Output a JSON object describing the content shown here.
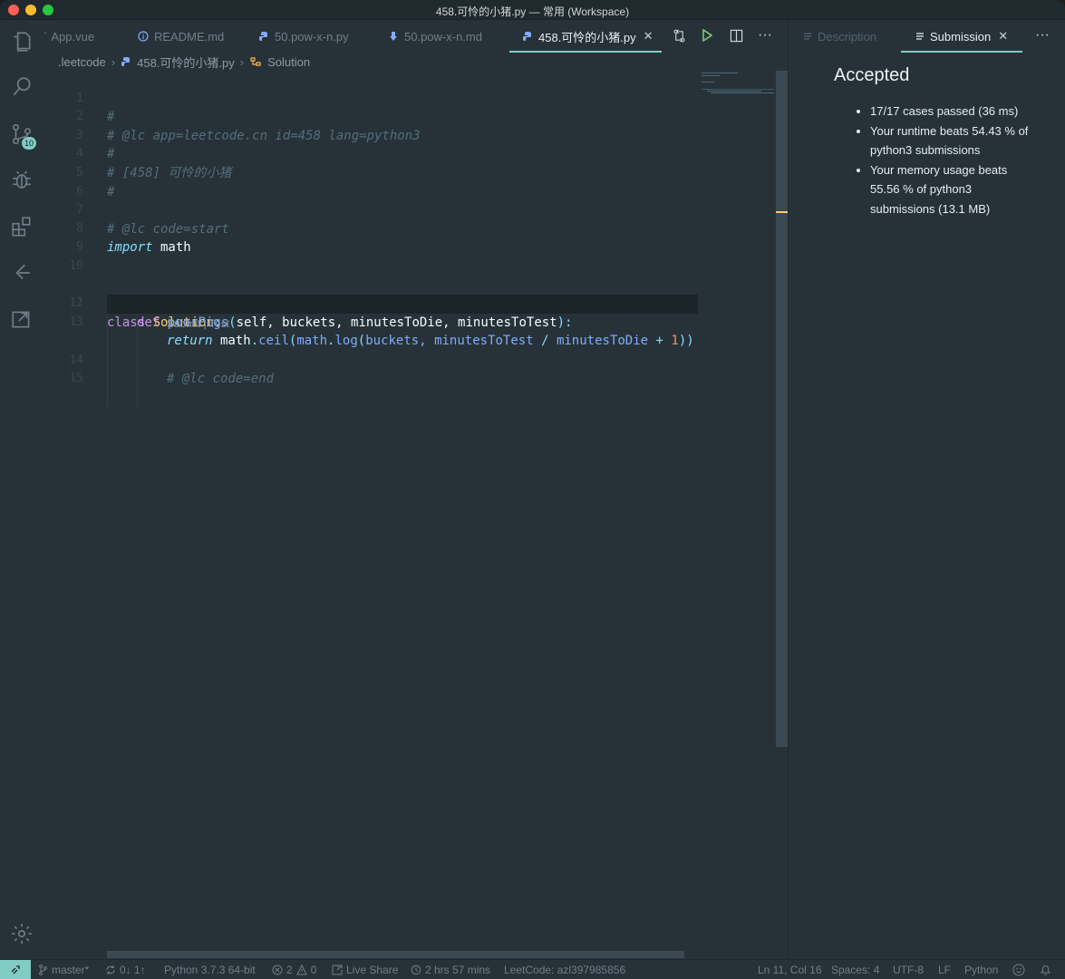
{
  "window": {
    "title": "458.可怜的小猪.py — 常用 (Workspace)"
  },
  "activity_bar": {
    "items": [
      {
        "name": "explorer-icon"
      },
      {
        "name": "search-icon"
      },
      {
        "name": "source-control-icon",
        "badge": "10"
      },
      {
        "name": "debug-icon"
      },
      {
        "name": "extensions-icon"
      },
      {
        "name": "leetcode-icon"
      },
      {
        "name": "remote-explorer-icon"
      }
    ],
    "settings": "gear-icon"
  },
  "tabs": [
    {
      "label": "App.vue",
      "icon": "vue-icon"
    },
    {
      "label": "README.md",
      "icon": "info-icon"
    },
    {
      "label": "50.pow-x-n.py",
      "icon": "python-icon"
    },
    {
      "label": "50.pow-x-n.md",
      "icon": "markdown-icon"
    },
    {
      "label": "458.可怜的小猪.py",
      "icon": "python-icon",
      "active": true
    }
  ],
  "editor_actions": [
    "compare-icon",
    "run-icon",
    "split-editor-icon",
    "more-icon"
  ],
  "breadcrumb": {
    "folder": ".leetcode",
    "file": "458.可怜的小猪.py",
    "symbol": "Solution"
  },
  "code": {
    "lines": [
      "1",
      "2",
      "3",
      "4",
      "5",
      "6",
      "7",
      "8",
      "9",
      "10",
      "11",
      "12",
      "13",
      "14",
      "15"
    ],
    "l1": "#",
    "l2": "# @lc app=leetcode.cn id=458 lang=python3",
    "l3": "#",
    "l4": "# [458] 可怜的小猪",
    "l5": "#",
    "l7": "# @lc code=start",
    "l8_kw": "import",
    "l8_mod": " math",
    "l11_kw": "class",
    "l11_cls": " Solution",
    "l11_colon": ":",
    "l12_kw": "def",
    "l12_fn": " poorPigs",
    "l12_open": "(",
    "l12_params": "self, buckets, minutesToDie, minutesToTest",
    "l12_close": "):",
    "l13_kw": "return",
    "l13_math1": " math",
    "l13_dot1": ".",
    "l13_ceil": "ceil",
    "l13_p1": "(",
    "l13_math2": "math",
    "l13_dot2": ".",
    "l13_log": "log",
    "l13_p2": "(",
    "l13_buckets": "buckets, ",
    "l13_mtt": "minutesToTest",
    "l13_div": " / ",
    "l13_mtd": "minutesToDie",
    "l13_plus": " + ",
    "l13_one": "1",
    "l13_close": "))",
    "codelens": "Submit | Test",
    "l14": "# @lc code=end"
  },
  "panel": {
    "tab_description": "Description",
    "tab_submission": "Submission",
    "result_title": "Accepted",
    "results": [
      "17/17 cases passed (36 ms)",
      "Your runtime beats 54.43 % of python3 submissions",
      "Your memory usage beats 55.56 % of python3 submissions (13.1 MB)"
    ]
  },
  "status_bar": {
    "branch": "master*",
    "sync": "0↓ 1↑",
    "interpreter": "Python 3.7.3 64-bit",
    "errors": "2",
    "warnings": "0",
    "live_share": "Live Share",
    "time": "2 hrs 57 mins",
    "leetcode": "LeetCode: azl397985856",
    "position": "Ln 11, Col 16",
    "spaces": "Spaces: 4",
    "encoding": "UTF-8",
    "eol": "LF",
    "language": "Python"
  }
}
